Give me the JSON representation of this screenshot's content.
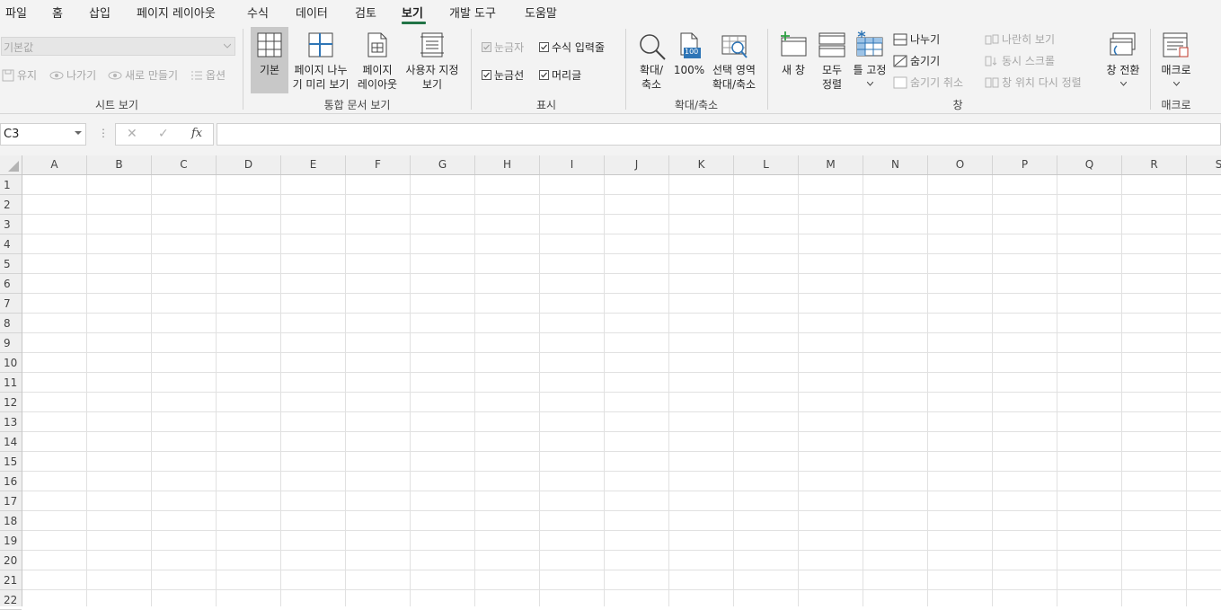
{
  "tabs": [
    {
      "label": "파일"
    },
    {
      "label": "홈"
    },
    {
      "label": "삽입"
    },
    {
      "label": "페이지 레이아웃"
    },
    {
      "label": "수식"
    },
    {
      "label": "데이터"
    },
    {
      "label": "검토"
    },
    {
      "label": "보기"
    },
    {
      "label": "개발 도구"
    },
    {
      "label": "도움말"
    }
  ],
  "active_tab": "보기",
  "accent_color": "#217346",
  "sheet_view": {
    "dropdown_value": "기본값",
    "keep": "유지",
    "exit": "나가기",
    "new": "새로 만들기",
    "options": "옵션",
    "group_label": "시트 보기"
  },
  "workbook_views": {
    "normal": "기본",
    "page_break_1": "페이지 나누",
    "page_break_2": "기 미리 보기",
    "page_layout_1": "페이지",
    "page_layout_2": "레이아웃",
    "custom_1": "사용자 지정",
    "custom_2": "보기",
    "group_label": "통합 문서 보기"
  },
  "show": {
    "ruler": "눈금자",
    "formula_bar": "수식 입력줄",
    "gridlines": "눈금선",
    "headings": "머리글",
    "group_label": "표시"
  },
  "zoom": {
    "zoom_1": "확대/",
    "zoom_2": "축소",
    "hundred": "100%",
    "hundred_icon_text": "100",
    "selection_1": "선택 영역",
    "selection_2": "확대/축소",
    "group_label": "확대/축소"
  },
  "window": {
    "new_window": "새 창",
    "arrange_1": "모두",
    "arrange_2": "정렬",
    "freeze": "틀 고정",
    "split": "나누기",
    "hide": "숨기기",
    "unhide": "숨기기 취소",
    "side_by_side": "나란히 보기",
    "sync_scroll": "동시 스크롤",
    "reset_position": "창 위치 다시 정렬",
    "switch": "창 전환",
    "group_label": "창"
  },
  "macros": {
    "label": "매크로",
    "group_label": "매크로"
  },
  "formula_bar": {
    "name_box": "C3",
    "cancel_glyph": "✕",
    "enter_glyph": "✓",
    "fx_glyph": "fx",
    "more_glyph": "⋮",
    "value": ""
  },
  "columns": [
    "A",
    "B",
    "C",
    "D",
    "E",
    "F",
    "G",
    "H",
    "I",
    "J",
    "K",
    "L",
    "M",
    "N",
    "O",
    "P",
    "Q",
    "R",
    "S"
  ],
  "rows": [
    "1",
    "2",
    "3",
    "4",
    "5",
    "6",
    "7",
    "8",
    "9",
    "10",
    "11",
    "12",
    "13",
    "14",
    "15",
    "16",
    "17",
    "18",
    "19",
    "20",
    "21",
    "22"
  ]
}
